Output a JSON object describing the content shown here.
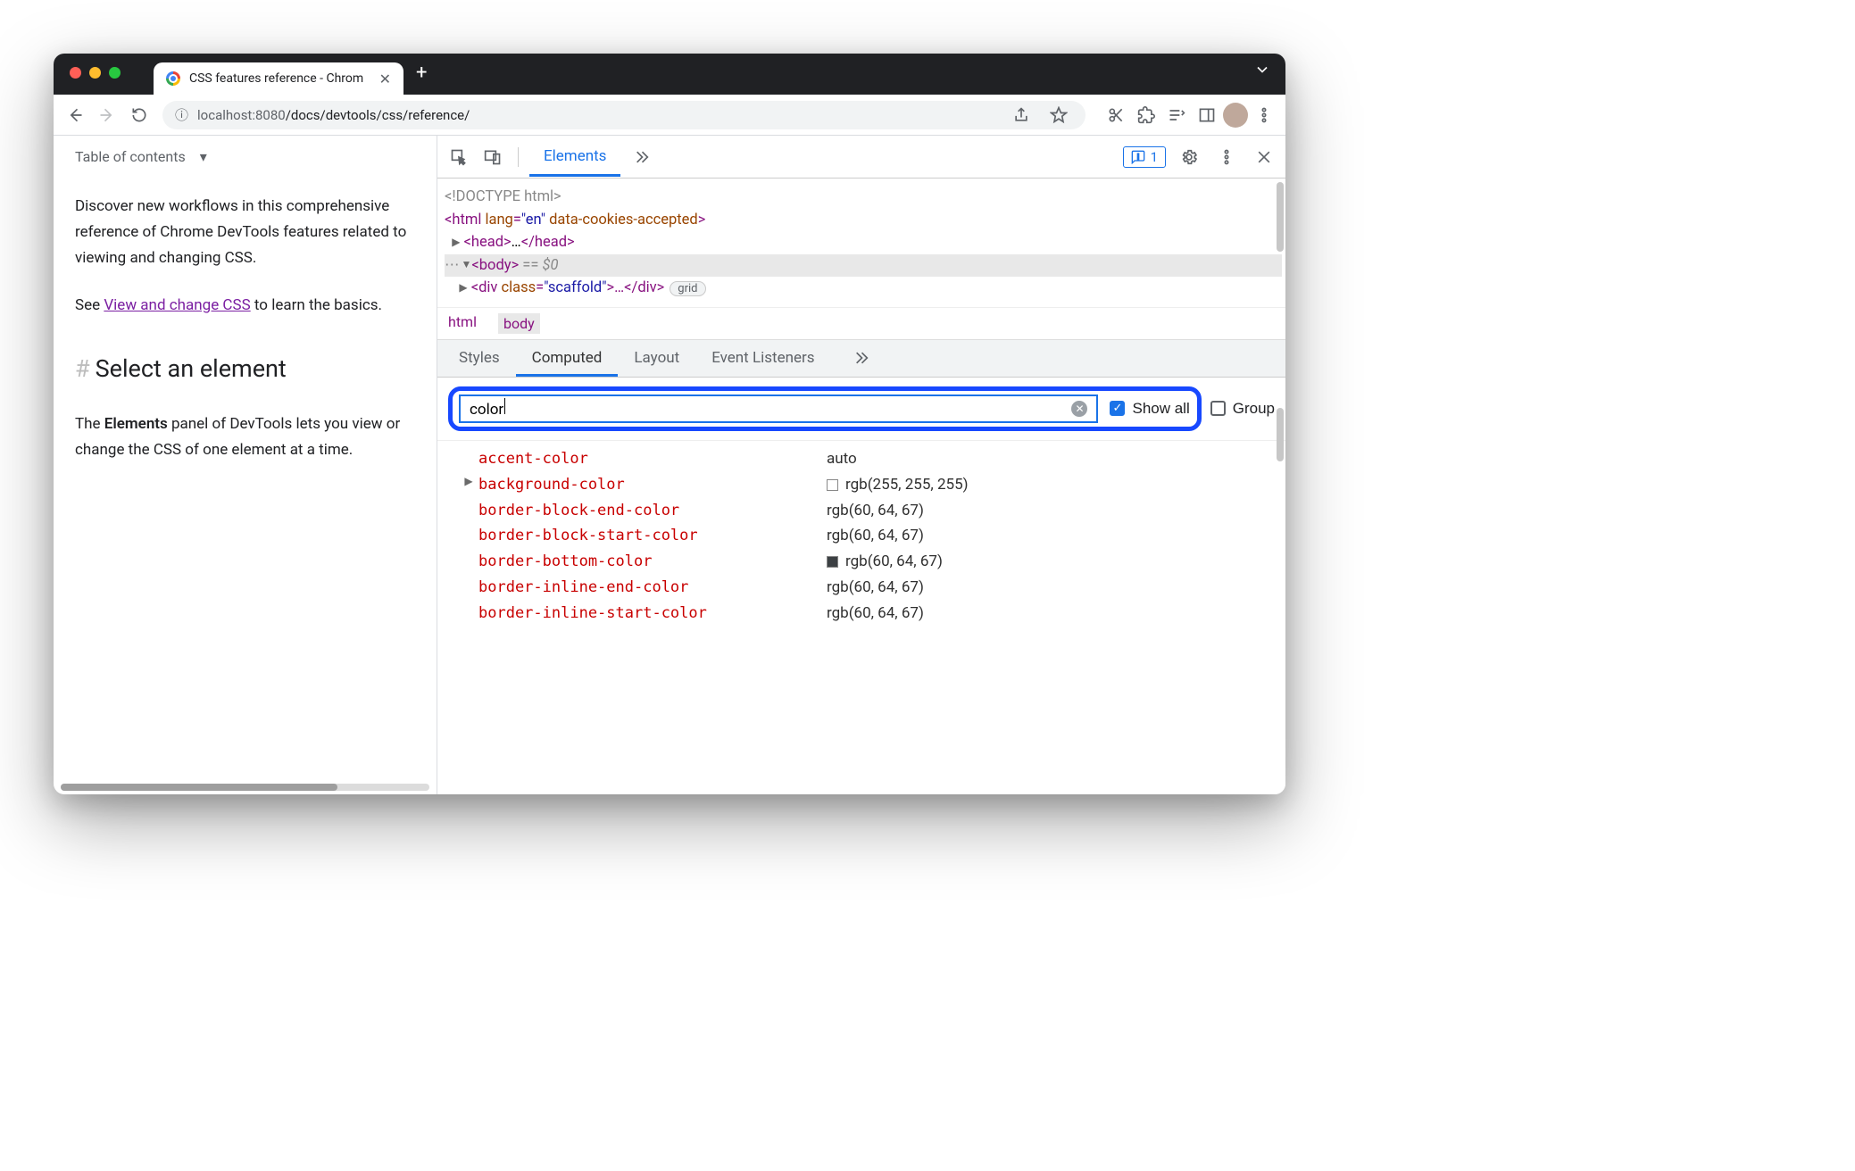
{
  "tab": {
    "title": "CSS features reference - Chrom"
  },
  "url": {
    "host_gray": "localhost",
    "host_port": ":8080",
    "path": "/docs/devtools/css/reference/"
  },
  "page": {
    "toc": "Table of contents",
    "p1": "Discover new workflows in this comprehensive reference of Chrome DevTools features related to viewing and changing CSS.",
    "p2a": "See ",
    "link": "View and change CSS",
    "p2b": " to learn the basics.",
    "h2": "Select an element",
    "p3a": "The ",
    "p3b": "Elements",
    "p3c": " panel of DevTools lets you view or change the CSS of one element at a time."
  },
  "devtools": {
    "main_tabs": {
      "elements": "Elements"
    },
    "issues": "1",
    "dom": {
      "doctype": "<!DOCTYPE html>",
      "html_open": "<html ",
      "lang_attr": "lang",
      "lang_val": "\"en\"",
      "cookies_attr": " data-cookies-accepted",
      "html_close": ">",
      "head": "<head>",
      "head_mid": "…",
      "head_end": "</head>",
      "body": "<body>",
      "body_eq": " == ",
      "body_dollar": "$0",
      "div_open": "<div ",
      "class_attr": "class",
      "class_val": "\"scaffold\"",
      "div_mid": ">…",
      "div_end": "</div>",
      "grid_pill": "grid"
    },
    "breadcrumb": [
      "html",
      "body"
    ],
    "side_tabs": [
      "Styles",
      "Computed",
      "Layout",
      "Event Listeners"
    ],
    "filter": {
      "value": "color",
      "show_all": "Show all",
      "group": "Group"
    },
    "props": [
      {
        "name": "accent-color",
        "value": "auto",
        "expand": false,
        "swatch": null
      },
      {
        "name": "background-color",
        "value": "rgb(255, 255, 255)",
        "expand": true,
        "swatch": "w"
      },
      {
        "name": "border-block-end-color",
        "value": "rgb(60, 64, 67)",
        "expand": false,
        "swatch": null
      },
      {
        "name": "border-block-start-color",
        "value": "rgb(60, 64, 67)",
        "expand": false,
        "swatch": null
      },
      {
        "name": "border-bottom-color",
        "value": "rgb(60, 64, 67)",
        "expand": false,
        "swatch": "g"
      },
      {
        "name": "border-inline-end-color",
        "value": "rgb(60, 64, 67)",
        "expand": false,
        "swatch": null
      },
      {
        "name": "border-inline-start-color",
        "value": "rgb(60, 64, 67)",
        "expand": false,
        "swatch": null
      }
    ]
  }
}
